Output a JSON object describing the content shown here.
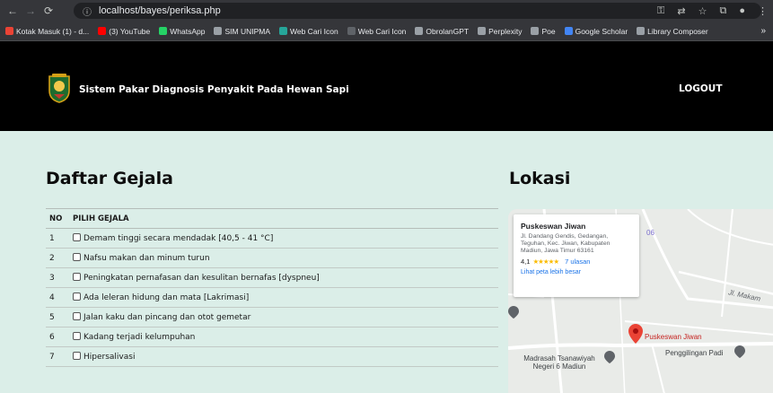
{
  "browser": {
    "url": "localhost/bayes/periksa.php",
    "bookmarks": [
      {
        "label": "Kotak Masuk (1) - d...",
        "color": "#ea4335"
      },
      {
        "label": "(3) YouTube",
        "color": "#ff0000"
      },
      {
        "label": "WhatsApp",
        "color": "#25d366"
      },
      {
        "label": "SIM UNIPMA",
        "color": "#9aa0a6"
      },
      {
        "label": "Web Cari Icon",
        "color": "#26a69a"
      },
      {
        "label": "Web Cari Icon",
        "color": "#5f6368"
      },
      {
        "label": "ObrolanGPT",
        "color": "#9aa0a6"
      },
      {
        "label": "Perplexity",
        "color": "#9aa0a6"
      },
      {
        "label": "Poe",
        "color": "#9aa0a6"
      },
      {
        "label": "Google Scholar",
        "color": "#4285f4"
      },
      {
        "label": "Library Composer",
        "color": "#9aa0a6"
      }
    ],
    "more": "»"
  },
  "header": {
    "title": "Sistem Pakar Diagnosis Penyakit Pada Hewan Sapi",
    "logout": "LOGOUT"
  },
  "gejala": {
    "heading": "Daftar Gejala",
    "col_no": "NO",
    "col_pilih": "PILIH GEJALA",
    "rows": [
      {
        "no": "1",
        "label": "Demam tinggi secara mendadak [40,5 - 41 °C]"
      },
      {
        "no": "2",
        "label": "Nafsu makan dan minum turun"
      },
      {
        "no": "3",
        "label": "Peningkatan pernafasan dan kesulitan bernafas [dyspneu]"
      },
      {
        "no": "4",
        "label": "Ada leleran hidung dan mata [Lakrimasi]"
      },
      {
        "no": "5",
        "label": "Jalan kaku dan pincang dan otot gemetar"
      },
      {
        "no": "6",
        "label": "Kadang terjadi kelumpuhan"
      },
      {
        "no": "7",
        "label": "Hipersalivasi"
      }
    ]
  },
  "lokasi": {
    "heading": "Lokasi",
    "place_name": "Puskeswan Jiwan",
    "address": "Jl. Dandang Gendis, Gedangan, Teguhan, Kec. Jiwan, Kabupaten Madiun, Jawa Timur 63161",
    "rating": "4,1",
    "stars": "★★★★★",
    "reviews": "7 ulasan",
    "view_larger": "Lihat peta lebih besar",
    "map_labels": {
      "pin": "Puskeswan Jiwan",
      "road": "Jl. Makam",
      "madrasah": "Madrasah Tsanawiyah\nNegeri 6 Madiun",
      "gilingan": "Penggilingan Padi",
      "road_num": "06"
    }
  }
}
